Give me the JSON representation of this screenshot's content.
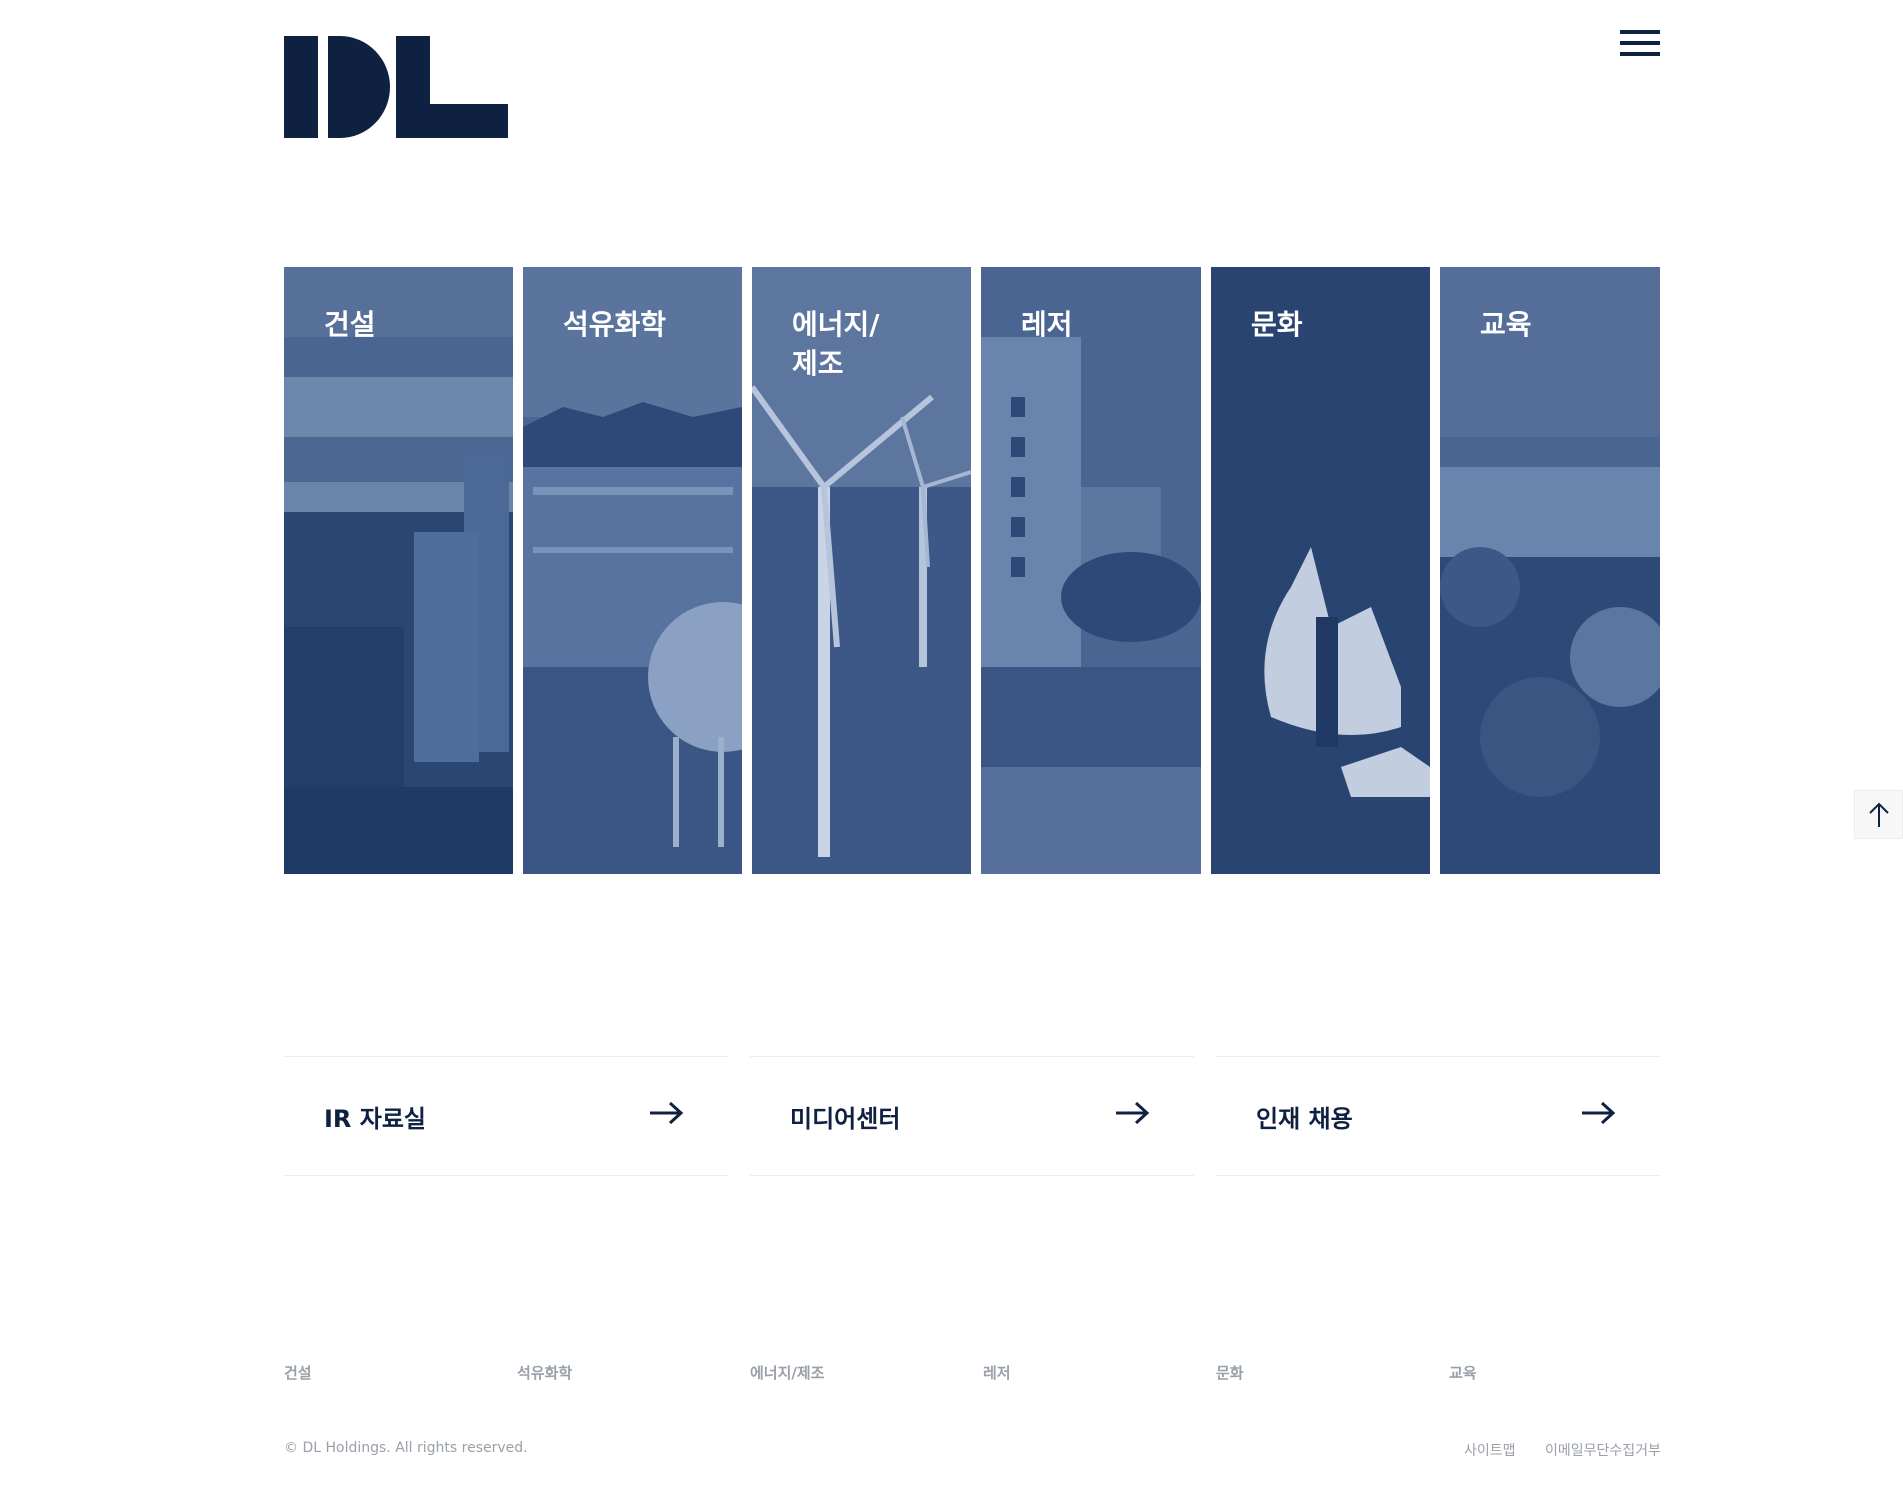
{
  "brand": {
    "logo_text": "DL",
    "navy": "#0f2141",
    "panel_tint": "#3d5583"
  },
  "header": {
    "menu_icon": "hamburger-menu-icon"
  },
  "panels": [
    {
      "label": "건설"
    },
    {
      "label": "석유화학"
    },
    {
      "label": "에너지/\n제조"
    },
    {
      "label": "레저"
    },
    {
      "label": "문화"
    },
    {
      "label": "교육"
    }
  ],
  "quick_links": [
    {
      "label": "IR 자료실",
      "icon": "arrow-right-icon"
    },
    {
      "label": "미디어센터",
      "icon": "arrow-right-icon"
    },
    {
      "label": "인재 채용",
      "icon": "arrow-right-icon"
    }
  ],
  "footer": {
    "categories": [
      "건설",
      "석유화학",
      "에너지/제조",
      "레저",
      "문화",
      "교육"
    ],
    "copyright": "© DL Holdings. All rights reserved.",
    "sitemap": "사이트맵",
    "email_refusal": "이메일무단수집거부"
  },
  "scroll_top": {
    "icon": "arrow-up-icon"
  }
}
